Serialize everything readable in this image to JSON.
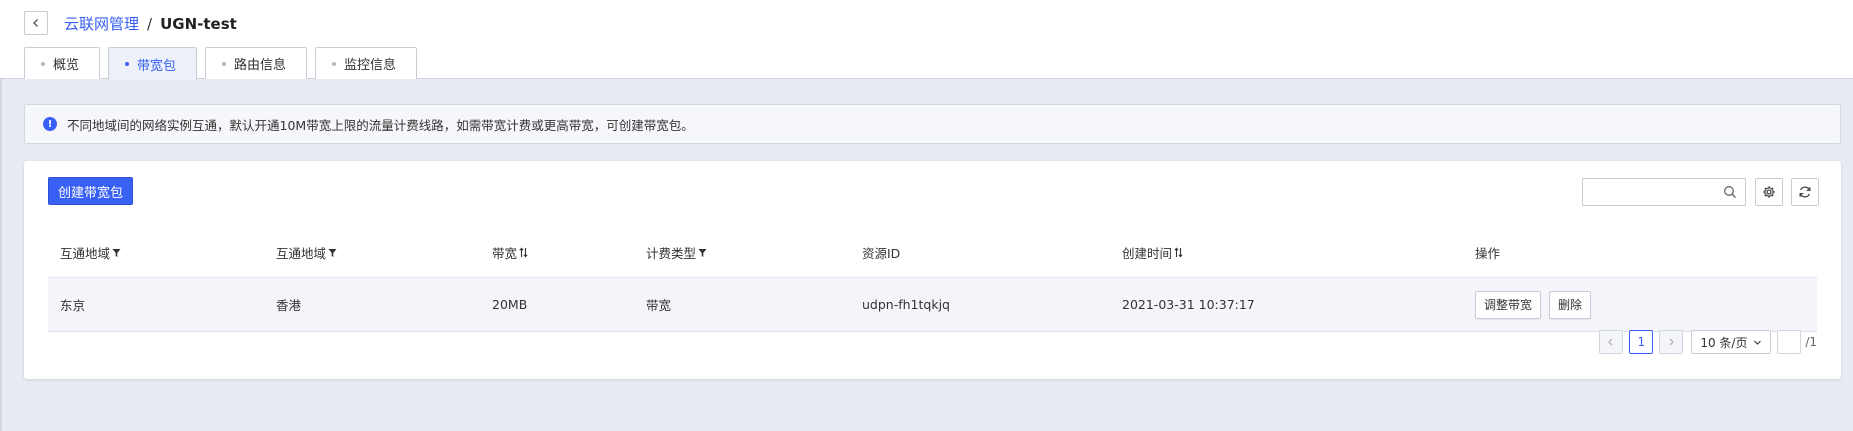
{
  "breadcrumb": {
    "parent": "云联网管理",
    "separator": "/",
    "current": "UGN-test"
  },
  "tabs": [
    {
      "label": "概览",
      "active": false
    },
    {
      "label": "带宽包",
      "active": true
    },
    {
      "label": "路由信息",
      "active": false
    },
    {
      "label": "监控信息",
      "active": false
    }
  ],
  "notice": {
    "icon": "info-icon",
    "text": "不同地域间的网络实例互通，默认开通10M带宽上限的流量计费线路，如需带宽计费或更高带宽，可创建带宽包。"
  },
  "toolbar": {
    "create_label": "创建带宽包",
    "search_placeholder": ""
  },
  "table": {
    "headers": [
      "互通地域",
      "互通地域",
      "带宽",
      "计费类型",
      "资源ID",
      "创建时间",
      "操作"
    ],
    "rows": [
      {
        "region_a": "东京",
        "region_b": "香港",
        "bandwidth": "20MB",
        "billing": "带宽",
        "resource_id": "udpn-fh1tqkjq",
        "created": "2021-03-31 10:37:17",
        "action_adjust": "调整带宽",
        "action_delete": "删除"
      }
    ]
  },
  "pagination": {
    "current_page": "1",
    "page_size": "10 条/页",
    "total": "/1"
  },
  "colors": {
    "accent": "#3860f4",
    "background": "#e9ebf3"
  }
}
